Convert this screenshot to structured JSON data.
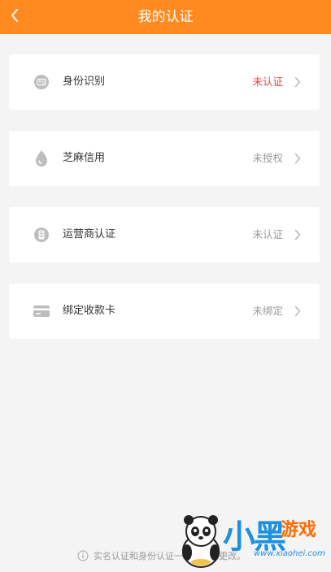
{
  "header": {
    "title": "我的认证",
    "bg_color": "#ff8a1f",
    "back_icon": "chevron-left-icon"
  },
  "items": [
    {
      "label": "身份识别",
      "status": "未认证",
      "status_color": "#f03a3a",
      "icon": "id-card-icon"
    },
    {
      "label": "芝麻信用",
      "status": "未授权",
      "status_color": "#999999",
      "icon": "drop-icon"
    },
    {
      "label": "运营商认证",
      "status": "未认证",
      "status_color": "#999999",
      "icon": "phone-icon"
    },
    {
      "label": "绑定收款卡",
      "status": "未绑定",
      "status_color": "#999999",
      "icon": "bank-card-icon"
    }
  ],
  "footer": {
    "note": "实名认证和身份认证一",
    "note_tail": "更改。",
    "icon": "info-icon"
  },
  "watermark": {
    "text": "小黑",
    "text2": "游戏",
    "url": "www.xiaohei.com"
  }
}
